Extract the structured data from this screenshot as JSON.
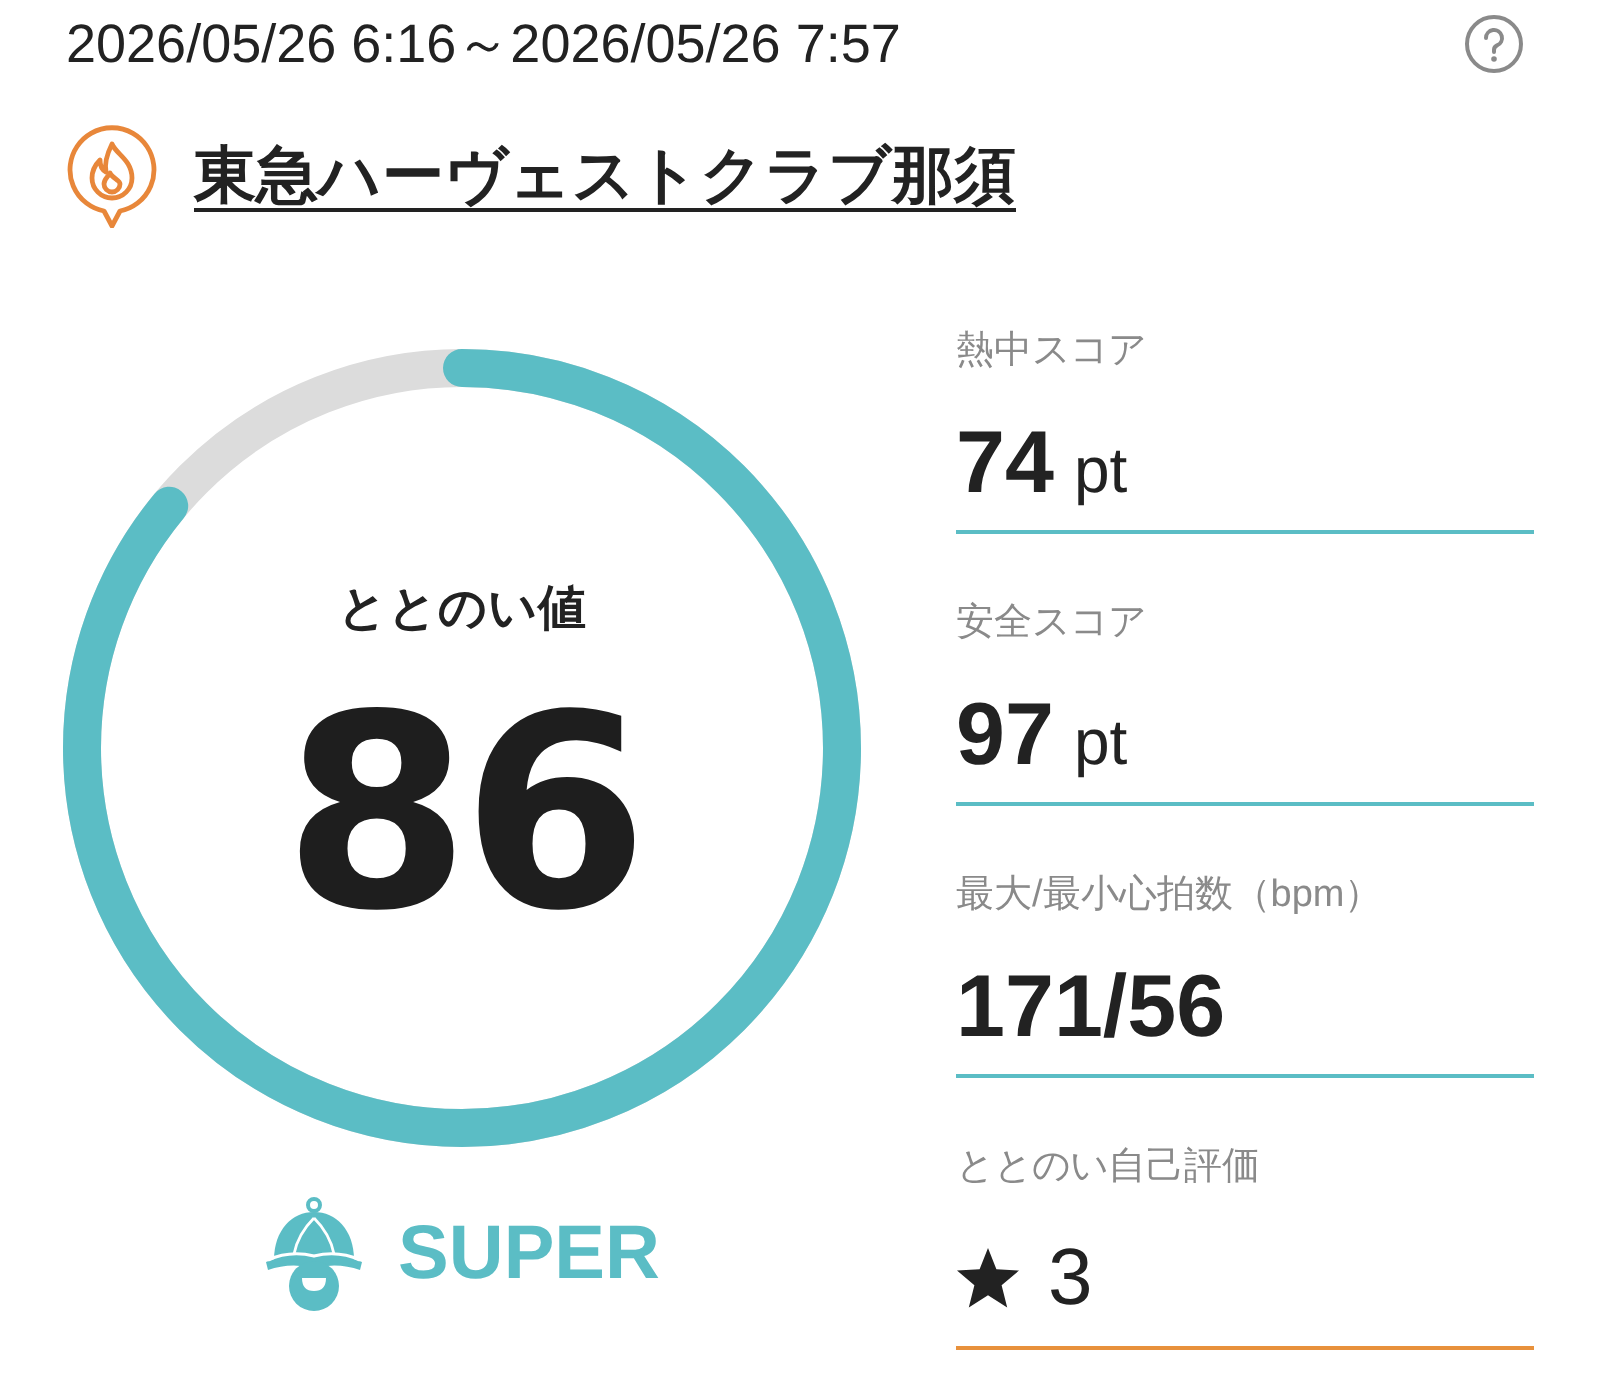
{
  "period": "2026/05/26 6:16～2026/05/26 7:57",
  "facility": {
    "name": "東急ハーヴェストクラブ那須"
  },
  "score": {
    "label": "ととのい値",
    "value": "86",
    "level": 0.86
  },
  "rank": {
    "label": "SUPER"
  },
  "metrics": [
    {
      "kind": "value",
      "label": "熱中スコア",
      "value": "74",
      "unit": "pt",
      "color": "#5bbdc5"
    },
    {
      "kind": "value",
      "label": "安全スコア",
      "value": "97",
      "unit": "pt",
      "color": "#5bbdc5"
    },
    {
      "kind": "value",
      "label": "最大/最小心拍数（bpm）",
      "value": "171/56",
      "color": "#5bbdc5"
    },
    {
      "kind": "rating",
      "label": "ととのい自己評価",
      "value": "3",
      "color": "#e8913c"
    }
  ]
}
